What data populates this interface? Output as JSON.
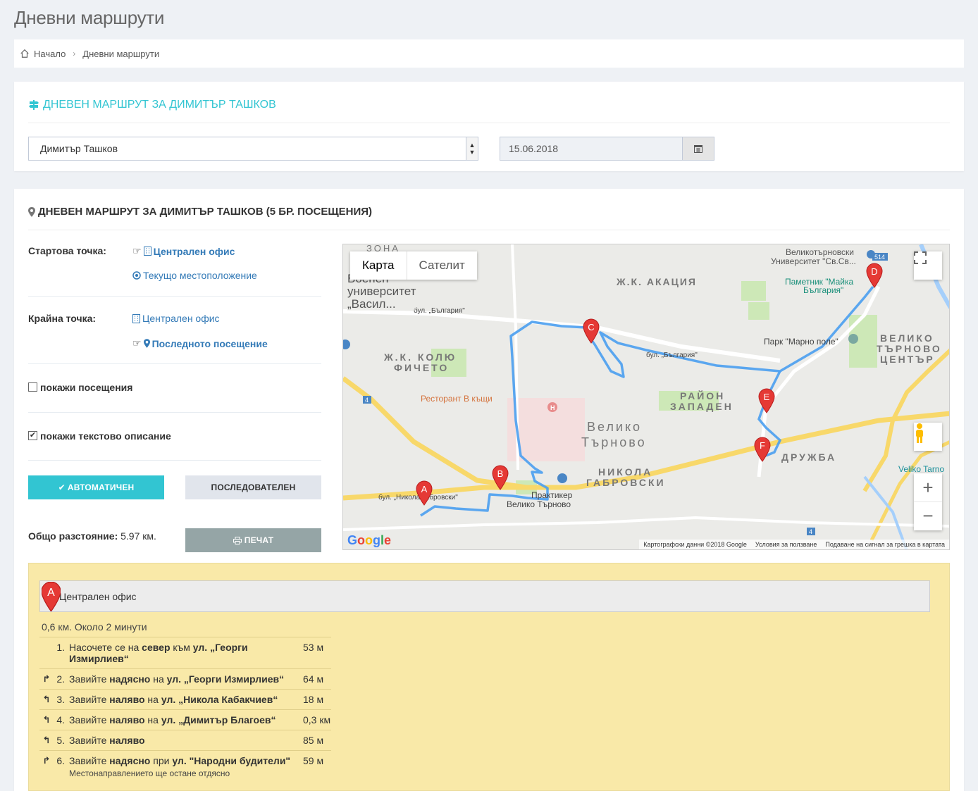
{
  "page": {
    "title": "Дневни маршрути"
  },
  "breadcrumb": {
    "home": "Начало",
    "current": "Дневни маршрути"
  },
  "selector_card": {
    "title": "ДНЕВЕН МАРШРУТ ЗА ДИМИТЪР ТАШКОВ",
    "person_value": "Димитър Ташков",
    "date_value": "15.06.2018"
  },
  "route_card": {
    "title": "ДНЕВЕН МАРШРУТ ЗА ДИМИТЪР ТАШКОВ (5 БР. ПОСЕЩЕНИЯ)",
    "start_label": "Стартова точка:",
    "start_opt1": "Централен офис",
    "start_opt2": "Текущо местоположение",
    "end_label": "Крайна точка:",
    "end_opt1": "Централен офис",
    "end_opt2": "Последното посещение",
    "show_visits": "покажи посещения",
    "show_text": "покажи текстово описание",
    "btn_auto": "АВТОМАТИЧЕН",
    "btn_seq": "ПОСЛЕДОВАТЕЛЕН",
    "total_label": "Общо разстояние:",
    "total_value": "5.97 км.",
    "btn_print": "ПЕЧАТ"
  },
  "map": {
    "tab_map": "Карта",
    "tab_satellite": "Сателит",
    "footer_data": "Картографски данни ©2018 Google",
    "footer_terms": "Условия за ползване",
    "footer_report": "Подаване на сигнал за грешка в картата",
    "markers": [
      "A",
      "B",
      "C",
      "D",
      "E",
      "F"
    ],
    "labels": {
      "zona": "ЗОНА",
      "university": "Военен\nуниверситет\n„Васил...",
      "akacia": "Ж.К. АКАЦИЯ",
      "kolyu1": "Ж.К. КОЛЮ",
      "kolyu2": "ФИЧЕТО",
      "raion1": "РАЙОН",
      "raion2": "ЗАПАДЕН",
      "vt1": "Велико",
      "vt2": "Търново",
      "nikola1": "НИКОЛА",
      "nikola2": "ГАБРОВСКИ",
      "druzhba": "ДРУЖБА",
      "center1": "ВЕЛИКО",
      "center2": "ТЪРНОВО",
      "center3": "ЦЕНТЪР",
      "restaurant": "Ресторант В къщи",
      "praktiker1": "Практикер",
      "praktiker2": "Велико Търново",
      "park": "Парк \"Марно поле\"",
      "pametnik1": "Паметник \"Майка",
      "pametnik2": "България\"",
      "vtu1": "Великотърновски",
      "vtu2": "Университет \"Св.Св...",
      "veliko_tarno": "Veliko Tarno",
      "bulgaria_blvd": "бул. „България\"",
      "bulgaria_blvd2": "бул. „България\"",
      "nikola_gabrovski_blvd": "бул. „Никола Габровски\"",
      "road_514": "514",
      "road_4a": "4",
      "road_4b": "4"
    }
  },
  "directions": {
    "start_point": "Централен офис",
    "summary": "0,6 км. Около 2 минути",
    "steps": [
      {
        "turn": "",
        "num": "1.",
        "pre": "Насочете се на ",
        "b1": "север",
        "mid": " към ",
        "b2": "ул. „Георги Измирлиев“",
        "post": "",
        "dist": "53 м",
        "note": ""
      },
      {
        "turn": "↱",
        "num": "2.",
        "pre": "Завийте ",
        "b1": "надясно",
        "mid": " на ",
        "b2": "ул. „Георги Измирлиев“",
        "post": "",
        "dist": "64 м",
        "note": ""
      },
      {
        "turn": "↰",
        "num": "3.",
        "pre": "Завийте ",
        "b1": "наляво",
        "mid": " на ",
        "b2": "ул. „Никола Кабакчиев“",
        "post": "",
        "dist": "18 м",
        "note": ""
      },
      {
        "turn": "↰",
        "num": "4.",
        "pre": "Завийте ",
        "b1": "наляво",
        "mid": " на ",
        "b2": "ул. „Димитър Благоев“",
        "post": "",
        "dist": "0,3 км",
        "note": ""
      },
      {
        "turn": "↰",
        "num": "5.",
        "pre": "Завийте ",
        "b1": "наляво",
        "mid": "",
        "b2": "",
        "post": "",
        "dist": "85 м",
        "note": ""
      },
      {
        "turn": "↱",
        "num": "6.",
        "pre": "Завийте ",
        "b1": "надясно",
        "mid": " при ",
        "b2": "ул. \"Народни будители\"",
        "post": "",
        "dist": "59 м",
        "note": "Местонаправлението ще остане отдясно"
      }
    ]
  },
  "colors": {
    "accent": "#32c5d2",
    "link": "#337ab7",
    "route": "#4a9ff0",
    "marker": "#e53935"
  }
}
